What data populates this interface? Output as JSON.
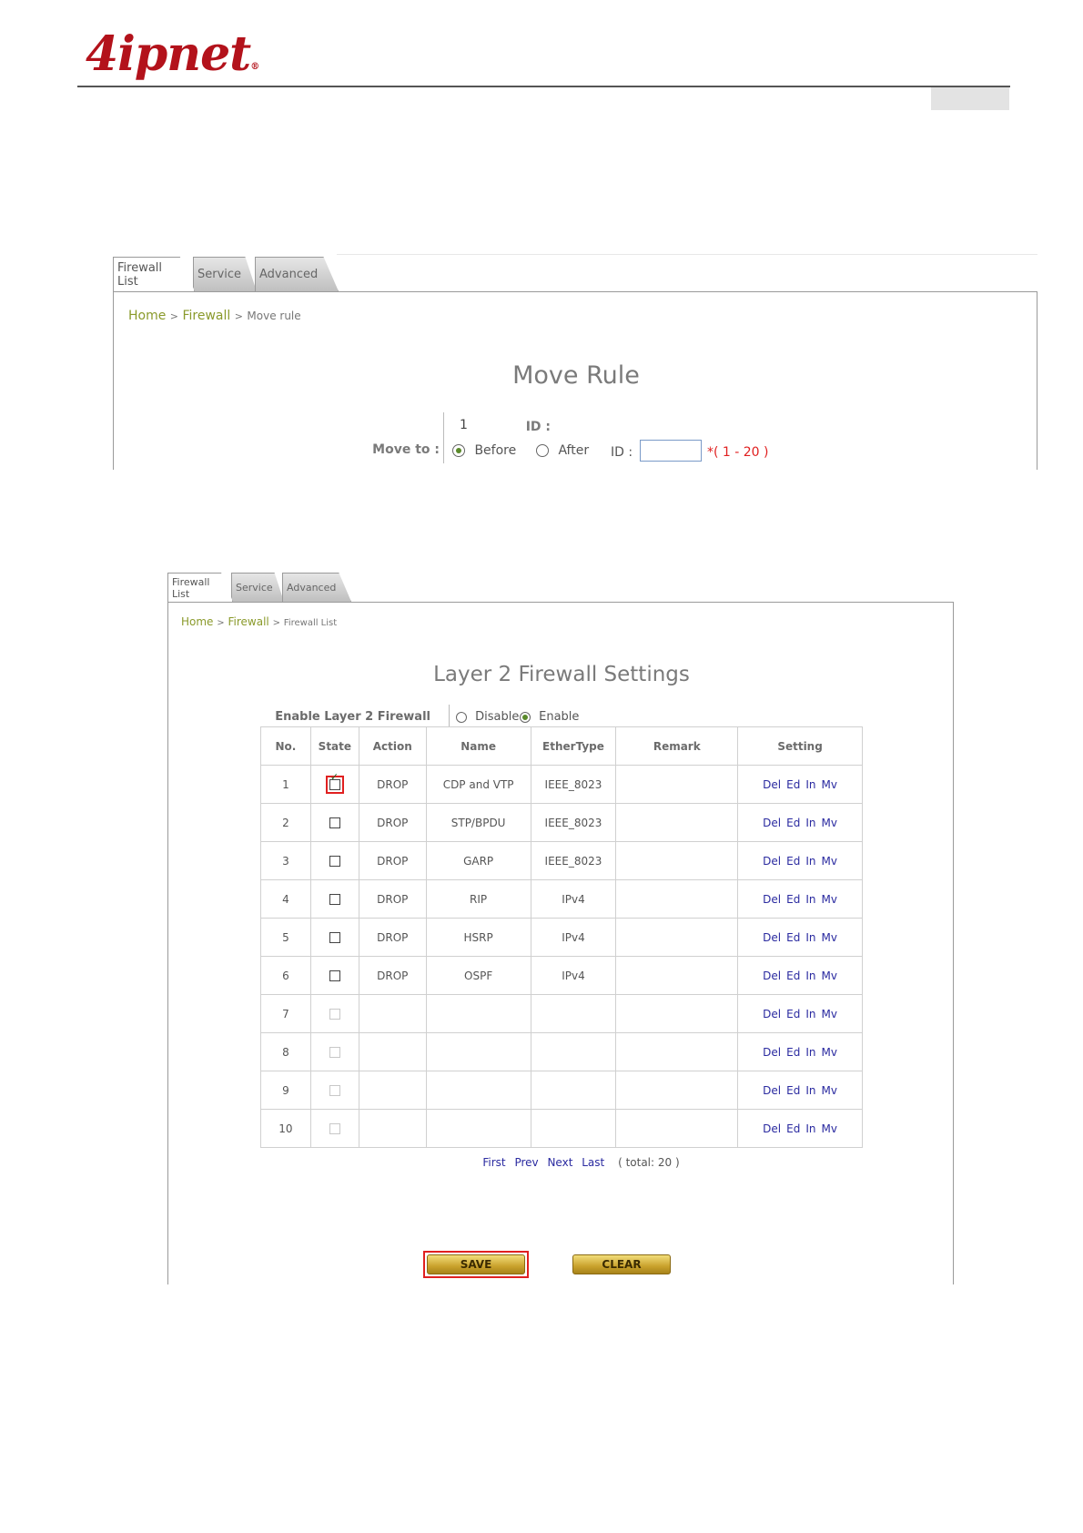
{
  "header": {
    "logo_text": "4ipnet",
    "registered_mark": "®"
  },
  "move_rule": {
    "tabs": [
      "Firewall List",
      "Service",
      "Advanced"
    ],
    "breadcrumb": {
      "home": "Home",
      "sep": ">",
      "firewall": "Firewall",
      "current": "Move rule"
    },
    "title": "Move Rule",
    "id_label": "ID :",
    "id_value": "1",
    "move_to_label": "Move to :",
    "before_label": "Before",
    "after_label": "After",
    "target_id_label": "ID :",
    "target_id_value": "",
    "range_hint": "*( 1 - 20 )",
    "selected": "Before"
  },
  "firewall_list": {
    "tabs": [
      "Firewall List",
      "Service",
      "Advanced"
    ],
    "breadcrumb": {
      "home": "Home",
      "sep": ">",
      "firewall": "Firewall",
      "current": "Firewall List"
    },
    "title": "Layer 2 Firewall Settings",
    "enable_label": "Enable Layer 2 Firewall",
    "disable_option": "Disable",
    "enable_option": "Enable",
    "enabled": true,
    "columns": [
      "No.",
      "State",
      "Action",
      "Name",
      "EtherType",
      "Remark",
      "Setting"
    ],
    "rows": [
      {
        "no": "1",
        "state": "checked",
        "action": "DROP",
        "name": "CDP and VTP",
        "ethertype": "IEEE_8023",
        "remark": ""
      },
      {
        "no": "2",
        "state": "unchecked",
        "action": "DROP",
        "name": "STP/BPDU",
        "ethertype": "IEEE_8023",
        "remark": ""
      },
      {
        "no": "3",
        "state": "unchecked",
        "action": "DROP",
        "name": "GARP",
        "ethertype": "IEEE_8023",
        "remark": ""
      },
      {
        "no": "4",
        "state": "unchecked",
        "action": "DROP",
        "name": "RIP",
        "ethertype": "IPv4",
        "remark": ""
      },
      {
        "no": "5",
        "state": "unchecked",
        "action": "DROP",
        "name": "HSRP",
        "ethertype": "IPv4",
        "remark": ""
      },
      {
        "no": "6",
        "state": "unchecked",
        "action": "DROP",
        "name": "OSPF",
        "ethertype": "IPv4",
        "remark": ""
      },
      {
        "no": "7",
        "state": "disabled",
        "action": "",
        "name": "",
        "ethertype": "",
        "remark": ""
      },
      {
        "no": "8",
        "state": "disabled",
        "action": "",
        "name": "",
        "ethertype": "",
        "remark": ""
      },
      {
        "no": "9",
        "state": "disabled",
        "action": "",
        "name": "",
        "ethertype": "",
        "remark": ""
      },
      {
        "no": "10",
        "state": "disabled",
        "action": "",
        "name": "",
        "ethertype": "",
        "remark": ""
      }
    ],
    "row_actions": [
      "Del",
      "Ed",
      "In",
      "Mv"
    ],
    "pager": {
      "first": "First",
      "prev": "Prev",
      "next": "Next",
      "last": "Last",
      "total": "( total: 20 )"
    },
    "save_label": "SAVE",
    "clear_label": "CLEAR"
  },
  "colors": {
    "brand": "#b3121b",
    "breadcrumb": "#8a9a2b",
    "action_link": "#2a2aa0",
    "highlight": "#e02020",
    "button_gold": "#d4ac36"
  }
}
